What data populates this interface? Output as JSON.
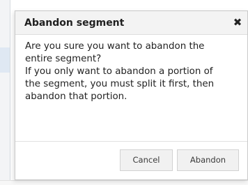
{
  "dialog": {
    "title": "Abandon segment",
    "close_symbol": "✖",
    "close_icon": "close-icon",
    "message_lines": [
      "Are you sure you want to abandon the",
      "entire segment?",
      "If you only want to abandon a portion of",
      "the segment, you must split it first, then",
      "abandon that portion."
    ],
    "buttons": {
      "cancel_label": "Cancel",
      "abandon_label": "Abandon"
    }
  },
  "colors": {
    "header_bg": "#f3f3f3",
    "button_bg": "#f1f1f1",
    "border": "#c9c9c9"
  }
}
